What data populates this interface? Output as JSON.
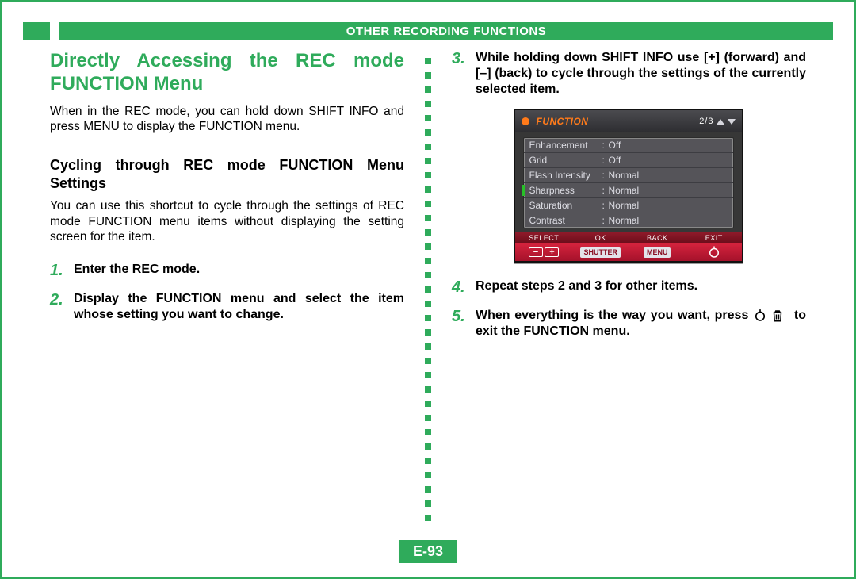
{
  "header": {
    "title": "OTHER RECORDING FUNCTIONS"
  },
  "page_number": "E-93",
  "left": {
    "h1": "Directly Accessing the REC mode FUNC­TION Menu",
    "intro": "When in the REC mode, you can hold down SHIFT INFO and press MENU to display the FUNCTION menu.",
    "h2": "Cycling through REC mode FUNCTION Menu Settings",
    "para": "You can use this shortcut to cycle through the settings of REC mode FUNCTION menu items without displaying the setting screen for the item.",
    "steps": [
      {
        "num": "1.",
        "text": "Enter the REC mode."
      },
      {
        "num": "2.",
        "text": "Display the FUNCTION menu and select the item whose setting you want to change."
      }
    ]
  },
  "right": {
    "steps_a": [
      {
        "num": "3.",
        "text": "While holding down SHIFT INFO use [+] (for­ward) and [–] (back) to cycle through the set­tings of the currently selected item."
      }
    ],
    "steps_b": [
      {
        "num": "4.",
        "text": "Repeat steps 2 and 3 for other items."
      },
      {
        "num": "5.",
        "text_pre": "When everything is the way you want, press",
        "text_post": " to exit the FUNCTION menu."
      }
    ]
  },
  "lcd": {
    "title": "FUNCTION",
    "page_ind": "2/3",
    "rows": [
      {
        "k": "Enhancement",
        "v": "Off",
        "sel": false
      },
      {
        "k": "Grid",
        "v": "Off",
        "sel": false
      },
      {
        "k": "Flash Intensity",
        "v": "Normal",
        "sel": false
      },
      {
        "k": "Sharpness",
        "v": "Normal",
        "sel": true
      },
      {
        "k": "Saturation",
        "v": "Normal",
        "sel": false
      },
      {
        "k": "Contrast",
        "v": "Normal",
        "sel": false
      }
    ],
    "foot_labels": [
      "SELECT",
      "OK",
      "BACK",
      "EXIT"
    ],
    "foot_btns_text": {
      "shutter": "SHUTTER",
      "menu": "MENU"
    }
  }
}
